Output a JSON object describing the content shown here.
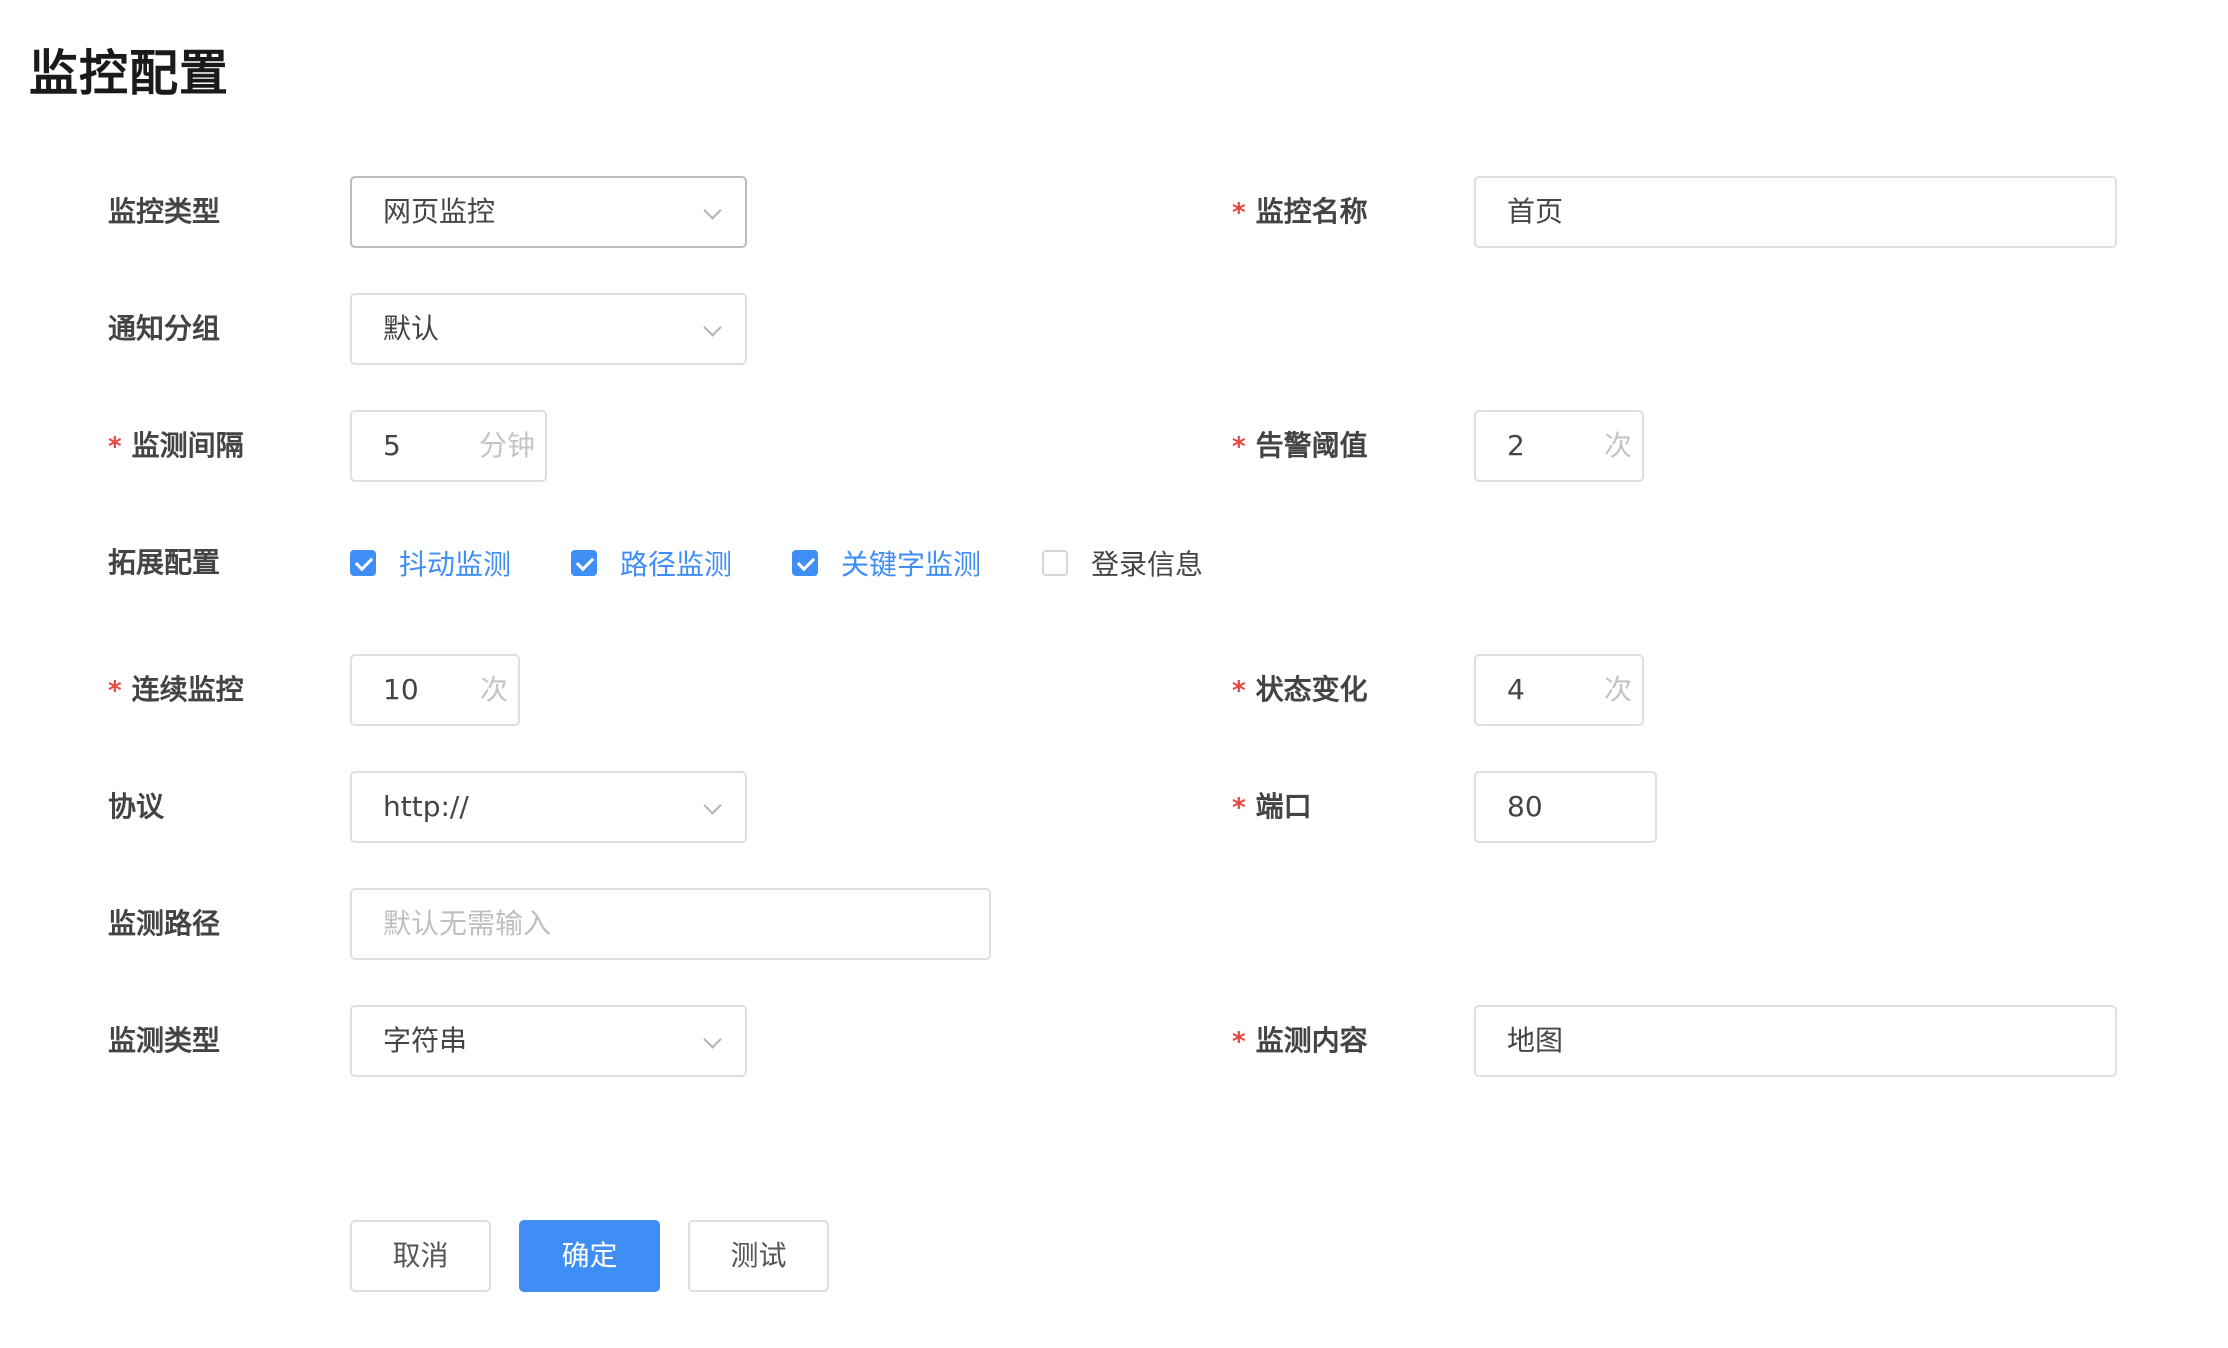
{
  "page": {
    "title": "监控配置"
  },
  "form": {
    "monitor_type": {
      "label": "监控类型",
      "value": "网页监控"
    },
    "monitor_name": {
      "label": "监控名称",
      "value": "首页"
    },
    "notify_group": {
      "label": "通知分组",
      "value": "默认"
    },
    "interval": {
      "label": "监测间隔",
      "value": "5",
      "unit": "分钟"
    },
    "alert_threshold": {
      "label": "告警阈值",
      "value": "2",
      "unit": "次"
    },
    "extension": {
      "label": "拓展配置",
      "options": [
        {
          "label": "抖动监测",
          "checked": true
        },
        {
          "label": "路径监测",
          "checked": true
        },
        {
          "label": "关键字监测",
          "checked": true
        },
        {
          "label": "登录信息",
          "checked": false
        }
      ]
    },
    "consecutive": {
      "label": "连续监控",
      "value": "10",
      "unit": "次"
    },
    "state_change": {
      "label": "状态变化",
      "value": "4",
      "unit": "次"
    },
    "protocol": {
      "label": "协议",
      "value": "http://"
    },
    "port": {
      "label": "端口",
      "value": "80"
    },
    "path": {
      "label": "监测路径",
      "placeholder": "默认无需输入"
    },
    "detect_type": {
      "label": "监测类型",
      "value": "字符串"
    },
    "detect_content": {
      "label": "监测内容",
      "value": "地图"
    },
    "required_mark": "*"
  },
  "actions": {
    "cancel": "取消",
    "confirm": "确定",
    "test": "测试"
  },
  "colors": {
    "accent": "#3f8ef5",
    "required": "#e8453c"
  }
}
